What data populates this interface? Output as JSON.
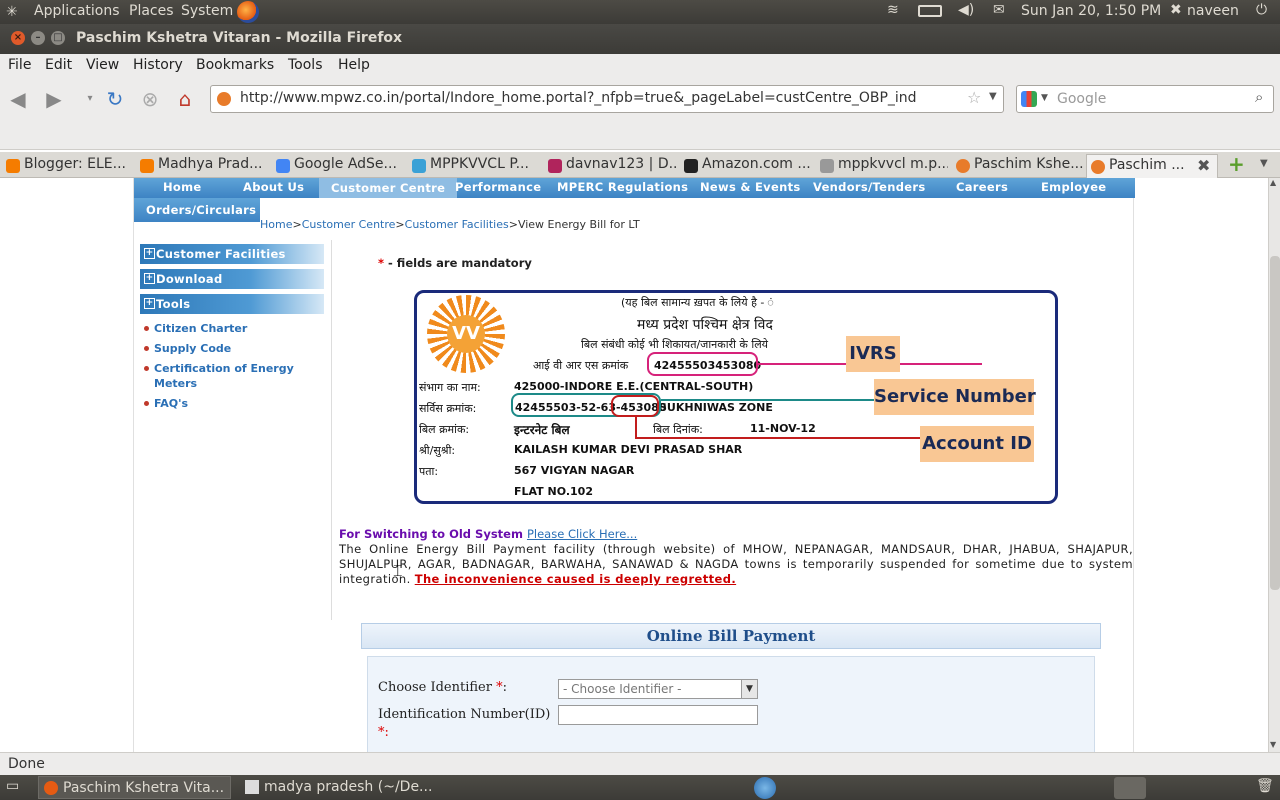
{
  "panel": {
    "applications": "Applications",
    "places": "Places",
    "system": "System",
    "clock": "Sun Jan 20,  1:50 PM",
    "user": "naveen"
  },
  "window": {
    "title": "Paschim Kshetra Vitaran - Mozilla Firefox"
  },
  "menu": [
    "File",
    "Edit",
    "View",
    "History",
    "Bookmarks",
    "Tools",
    "Help"
  ],
  "toolbar": {
    "url": "http://www.mpwz.co.in/portal/Indore_home.portal?_nfpb=true&_pageLabel=custCentre_OBP_ind",
    "search_placeholder": "Google"
  },
  "tabs": [
    "Blogger: ELE...",
    "Madhya Prad...",
    "Google AdSe...",
    "MPPKVVCL P...",
    "davnav123 | D...",
    "Amazon.com ...",
    "mppkvvcl m.p...",
    "Paschim Kshe...",
    "Paschim ..."
  ],
  "site": {
    "nav": [
      "Home",
      "About Us",
      "Customer Centre",
      "Performance",
      "MPERC Regulations",
      "News & Events",
      "Vendors/Tenders",
      "Careers",
      "Employee",
      "Orders/Circulars"
    ],
    "breadcrumb": [
      "Home",
      "Customer Centre",
      "Customer Facilities",
      "View Energy Bill for LT"
    ]
  },
  "sidebar": {
    "sections": [
      "Customer Facilities",
      "Download",
      "Tools"
    ],
    "links": [
      "Citizen Charter",
      "Supply Code",
      "Certification of Energy Meters",
      "FAQ's"
    ]
  },
  "content": {
    "asterisk": "*",
    "mandatory_note": "- fields are mandatory",
    "switch_label": "For Switching to Old System",
    "switch_link": "Please Click Here...",
    "notice": "The Online Energy Bill Payment facility (through website) of MHOW, NEPANAGAR, MANDSAUR, DHAR, JHABUA, SHAJAPUR, SHUJALPUR, AGAR, BADNAGAR, BARWAHA, SANAWAD & NAGDA towns is temporarily suspended for sometime due to system integration.",
    "regret": "The inconvenience caused is deeply regretted."
  },
  "bill": {
    "logo_text": "VV",
    "header1": "(यह बिल सामान्य ख़पत के लिये है - ं",
    "header2": "मध्य प्रदेश पश्चिम क्षेत्र विद",
    "header3": "बिल संबंधी कोई भी शिकायत/जानकारी के लिये",
    "ivrs_label": "आई वी आर एस क्रमांक",
    "ivrs_value": "42455503453080",
    "circle_label": "संभाग का नाम:",
    "circle_value": "425000-INDORE E.E.(CENTRAL-SOUTH)",
    "service_label": "सर्विस क्रमांक:",
    "service_value": "42455503-52-63-453080",
    "zone": "SUKHNIWAS ZONE",
    "billno_label": "बिल क्रमांक:",
    "billno_value": "इन्टरनेट बिल",
    "date_label": "बिल दिनांक:",
    "date_value": "11-NOV-12",
    "name_label": "श्री/सुश्री:",
    "name_value": "KAILASH KUMAR DEVI PRASAD SHAR",
    "address_label": "पता:",
    "address1": "567 VIGYAN NAGAR",
    "address2": "FLAT NO.102",
    "callout_ivrs": "IVRS",
    "callout_service": "Service Number",
    "callout_account": "Account ID"
  },
  "payment": {
    "title": "Online Bill Payment",
    "choose_label": "Choose Identifier",
    "required_mark": "*",
    "colon": ":",
    "choose_value": "- Choose Identifier -",
    "id_label": "Identification Number(ID)",
    "id_required": "*:"
  },
  "status": {
    "text": "Done"
  },
  "taskbar": [
    "Paschim Kshetra Vita...",
    "madya pradesh (~/De..."
  ]
}
